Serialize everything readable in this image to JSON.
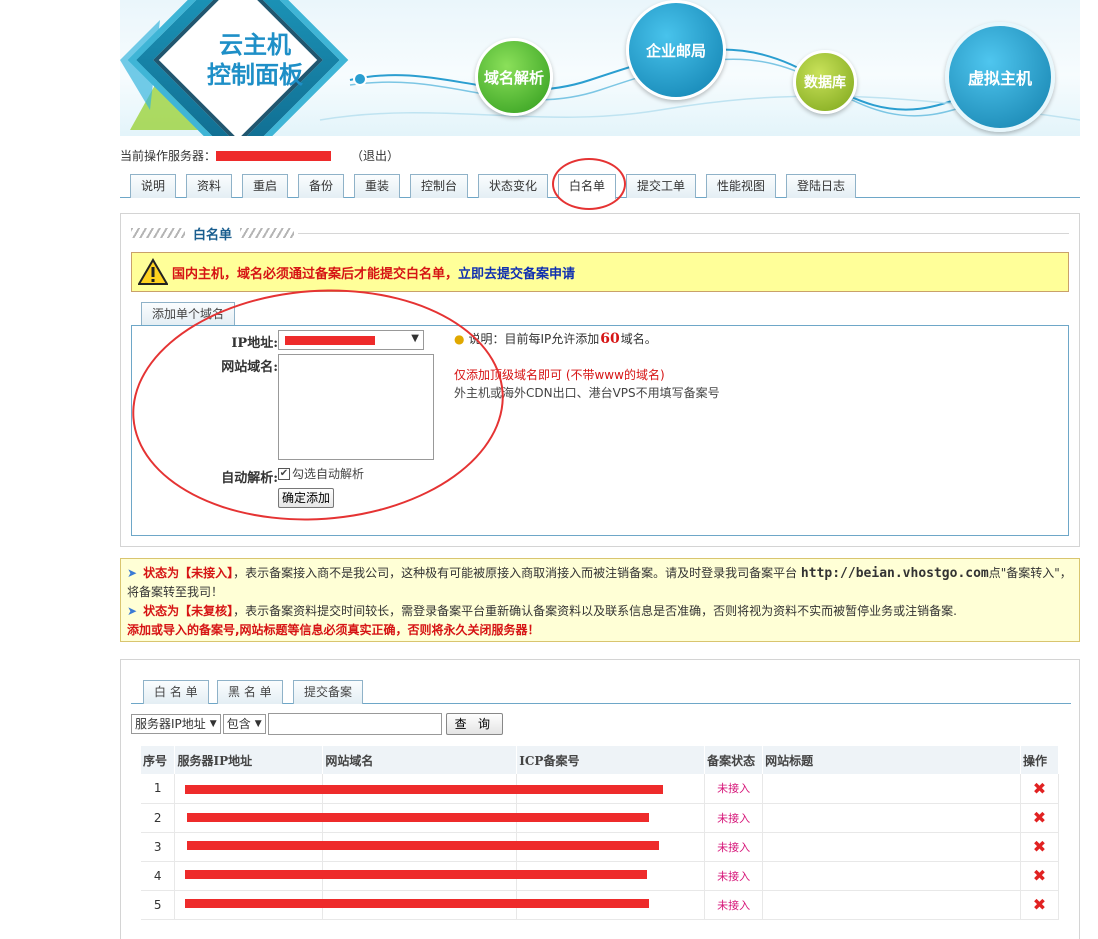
{
  "banner": {
    "logo_line1": "云主机",
    "logo_line2": "控制面板",
    "bubbles": {
      "domain": "域名解析",
      "mail": "企业邮局",
      "database": "数据库",
      "vhost": "虚拟主机"
    }
  },
  "server": {
    "label": "当前操作服务器：",
    "logout": "（退出）"
  },
  "tabs": [
    "说明",
    "资料",
    "重启",
    "备份",
    "重装",
    "控制台",
    "状态变化",
    "白名单",
    "提交工单",
    "性能视图",
    "登陆日志"
  ],
  "whitelist": {
    "title": "白名单",
    "warning_text": "国内主机，域名必须通过备案后才能提交白名单，",
    "warning_link": "立即去提交备案申请",
    "subtab": "添加单个域名",
    "ip_label": "IP地址:",
    "domain_label": "网站域名:",
    "auto_label": "自动解析:",
    "auto_checkbox_text": "勾选自动解析",
    "submit_label": "确定添加",
    "note_prefix": "说明：目前每IP允许添加",
    "note_count": "60",
    "note_suffix": "域名。",
    "note_red": "仅添加顶级域名即可 (不带www的域名)",
    "note_gray": "外主机或海外CDN出口、港台VPS不用填写备案号"
  },
  "notice": {
    "line1_status": "状态为【未接入】",
    "line1_text": "，表示备案接入商不是我公司，这种极有可能被原接入商取消接入而被注销备案。请及时登录我司备案平台",
    "line1_url": "http://beian.vhostgo.com",
    "line1_tail": "点\"备案转入\"，将备案转至我司！",
    "line2_status": "状态为【未复核】",
    "line2_text": "，表示备案资料提交时间较长，需登录备案平台重新确认备案资料以及联系信息是否准确，否则将视为资料不实而被暂停业务或注销备案.",
    "line3": "添加或导入的备案号,网站标题等信息必须真实正确，否则将永久关闭服务器！"
  },
  "list": {
    "tabs": [
      "白 名 单",
      "黑 名 单",
      "提交备案"
    ],
    "search_field": "服务器IP地址",
    "search_op": "包含",
    "search_button": "查 询",
    "columns": [
      "序号",
      "服务器IP地址",
      "网站域名",
      "ICP备案号",
      "备案状态",
      "网站标题",
      "操作"
    ],
    "rows": [
      {
        "no": "1",
        "status": "未接入",
        "op": "✖"
      },
      {
        "no": "2",
        "status": "未接入",
        "op": "✖"
      },
      {
        "no": "3",
        "status": "未接入",
        "op": "✖"
      },
      {
        "no": "4",
        "status": "未接入",
        "op": "✖"
      },
      {
        "no": "5",
        "status": "未接入",
        "op": "✖"
      }
    ]
  },
  "colors": {
    "accent": "#1a5e8f",
    "warning_red": "#d61414",
    "redaction": "#ee2b2b",
    "tab_border": "#8fb2c8"
  }
}
